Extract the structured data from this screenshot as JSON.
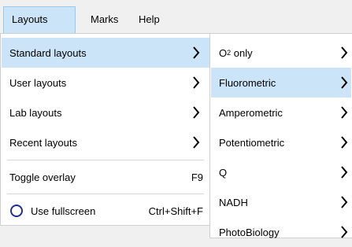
{
  "menubar": {
    "items": [
      {
        "label": "Layouts"
      },
      {
        "label": "Marks"
      },
      {
        "label": "Help"
      }
    ]
  },
  "layouts_menu": {
    "items": [
      {
        "label": "Standard layouts",
        "submenu": true
      },
      {
        "label": "User layouts",
        "submenu": true
      },
      {
        "label": "Lab layouts",
        "submenu": true
      },
      {
        "label": "Recent layouts",
        "submenu": true
      },
      {
        "label": "Toggle overlay",
        "shortcut": "F9"
      },
      {
        "label": "Use fullscreen",
        "shortcut": "Ctrl+Shift+F",
        "checked": false
      }
    ]
  },
  "standard_submenu": {
    "items": [
      {
        "label_main": "O",
        "label_sub": "2",
        "label_rest": " only"
      },
      {
        "label": "Fluorometric"
      },
      {
        "label": "Amperometric"
      },
      {
        "label": "Potentiometric"
      },
      {
        "label": "Q"
      },
      {
        "label": "NADH"
      },
      {
        "label": "PhotoBiology"
      }
    ]
  },
  "colors": {
    "highlight": "#cce4f7",
    "radio_ring": "#1f2f9a"
  },
  "icons": {
    "submenu_arrow": "chevron-right-icon",
    "radio": "radio-ring-icon"
  }
}
